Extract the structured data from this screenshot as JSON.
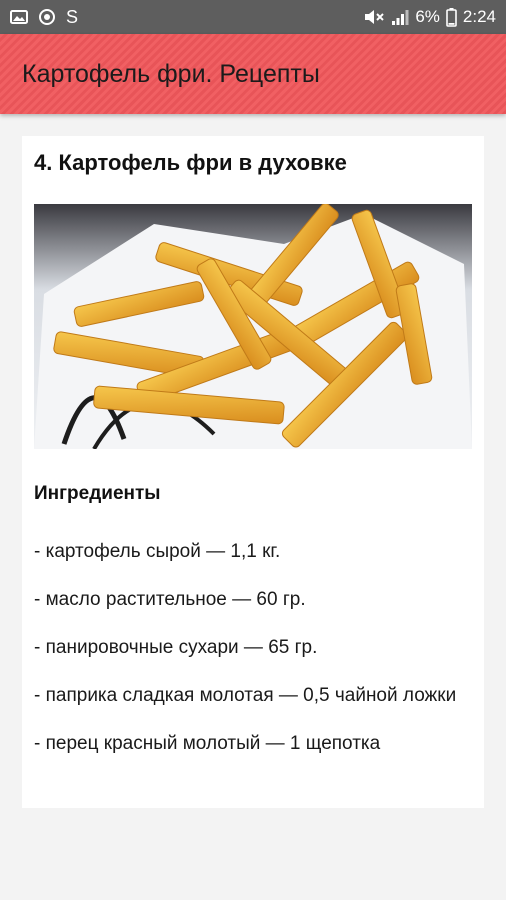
{
  "status_bar": {
    "battery_percent": "6%",
    "time": "2:24",
    "left_icons": [
      "image-icon",
      "target-icon",
      "s-icon"
    ],
    "right_icons": [
      "mute-icon",
      "signal-icon",
      "battery-icon"
    ],
    "status_s_glyph": "S"
  },
  "app_bar": {
    "title": "Картофель фри. Рецепты",
    "color": "#f0575b"
  },
  "recipe": {
    "title": "4. Картофель фри в духовке",
    "ingredients_heading": "Ингредиенты",
    "ingredients": [
      "- картофель сырой — 1,1 кг.",
      "- масло растительное — 60 гр.",
      "- панировочные сухари — 65 гр.",
      "- паприка сладкая молотая — 0,5 чайной ложки",
      "- перец красный молотый — 1 щепотка"
    ]
  }
}
